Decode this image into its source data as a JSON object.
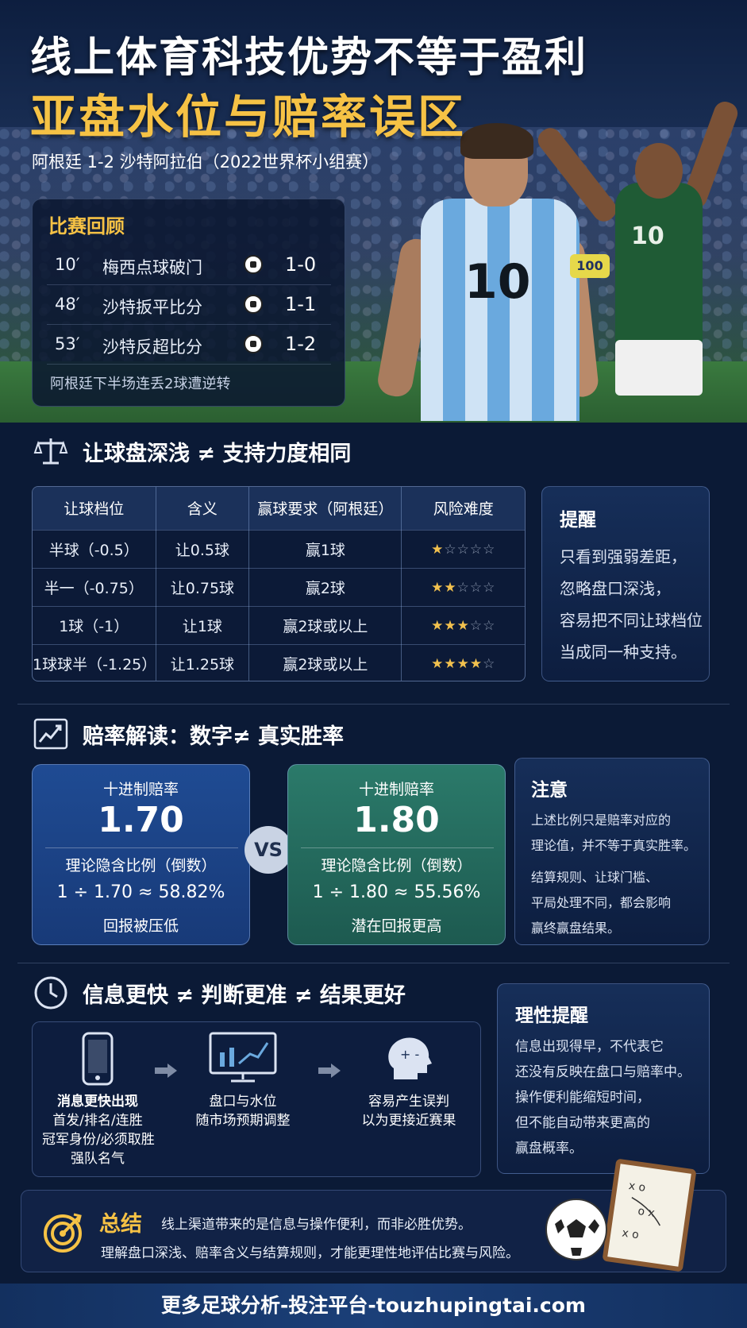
{
  "hero": {
    "title_line1": "线上体育科技优势不等于盈利",
    "title_line2": "亚盘水位与赔率误区",
    "subtitle": "阿根廷 1-2 沙特阿拉伯（2022世界杯小组赛）",
    "messi_number": "10",
    "captain_band": "100",
    "saudi_number": "10"
  },
  "review": {
    "title": "比赛回顾",
    "goals": [
      {
        "minute": "10′",
        "desc": "梅西点球破门",
        "score": "1-0"
      },
      {
        "minute": "48′",
        "desc": "沙特扳平比分",
        "score": "1-1"
      },
      {
        "minute": "53′",
        "desc": "沙特反超比分",
        "score": "1-2"
      }
    ],
    "note": "阿根廷下半场连丢2球遭逆转"
  },
  "handicap": {
    "heading": "让球盘深浅 ≠ 支持力度相同",
    "columns": [
      "让球档位",
      "含义",
      "赢球要求（阿根廷）",
      "风险难度"
    ],
    "rows": [
      {
        "level": "半球（-0.5）",
        "meaning": "让0.5球",
        "requirement": "赢1球",
        "risk": 1
      },
      {
        "level": "半一（-0.75）",
        "meaning": "让0.75球",
        "requirement": "赢2球",
        "risk": 2
      },
      {
        "level": "1球（-1）",
        "meaning": "让1球",
        "requirement": "赢2球或以上",
        "risk": 3
      },
      {
        "level": "1球球半（-1.25）",
        "meaning": "让1.25球",
        "requirement": "赢2球或以上",
        "risk": 4
      }
    ],
    "reminder": {
      "title": "提醒",
      "lines": [
        "只看到强弱差距，",
        "忽略盘口深浅，",
        "容易把不同让球档位",
        "当成同一种支持。"
      ]
    }
  },
  "odds": {
    "heading": "赔率解读：数字≠ 真实胜率",
    "cards": [
      {
        "label": "十进制赔率",
        "value": "1.70",
        "sub": "理论隐含比例（倒数）",
        "calc": "1 ÷ 1.70 ≈ 58.82%",
        "note": "回报被压低"
      },
      {
        "label": "十进制赔率",
        "value": "1.80",
        "sub": "理论隐含比例（倒数）",
        "calc": "1 ÷ 1.80 ≈ 55.56%",
        "note": "潜在回报更高"
      }
    ],
    "vs": "VS",
    "attention": {
      "title": "注意",
      "lines": [
        "上述比例只是赔率对应的",
        "理论值，并不等于真实胜率。",
        "结算规则、让球门槛、",
        "平局处理不同，都会影响",
        "赢终赢盘结果。"
      ]
    }
  },
  "info": {
    "heading": "信息更快 ≠ 判断更准 ≠ 结果更好",
    "steps": [
      {
        "lines": [
          "消息更快出现",
          "首发/排名/连胜",
          "冠军身份/必须取胜",
          "强队名气"
        ]
      },
      {
        "lines": [
          "盘口与水位",
          "随市场预期调整"
        ]
      },
      {
        "lines": [
          "容易产生误判",
          "以为更接近赛果"
        ]
      }
    ],
    "rational": {
      "title": "理性提醒",
      "lines": [
        "信息出现得早，不代表它",
        "还没有反映在盘口与赔率中。",
        "操作便利能缩短时间，",
        "但不能自动带来更高的",
        "赢盘概率。"
      ]
    }
  },
  "summary": {
    "title": "总结",
    "line1": "线上渠道带来的是信息与操作便利，而非必胜优势。",
    "line2": "理解盘口深浅、赔率含义与结算规则，才能更理性地评估比赛与风险。"
  },
  "footer": "更多足球分析-投注平台-touzhupingtai.com",
  "colors": {
    "accent": "#f6c245",
    "background": "#0b1a36",
    "star": "#f2c14e",
    "blue_card": "#1f4b93",
    "green_card": "#2b7a6a"
  }
}
